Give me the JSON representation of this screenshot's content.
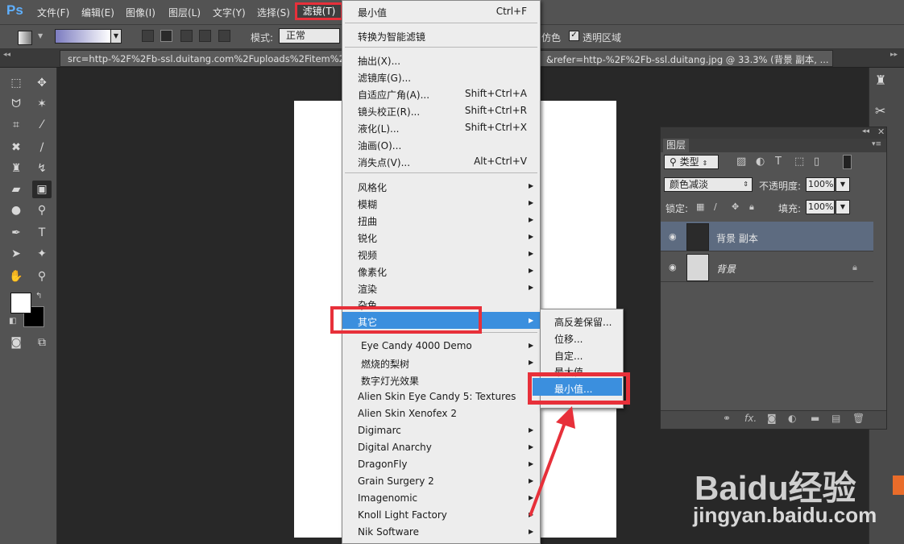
{
  "menubar": {
    "items": [
      "文件(F)",
      "编辑(E)",
      "图像(I)",
      "图层(L)",
      "文字(Y)",
      "选择(S)",
      "滤镜(T)"
    ],
    "active": "滤镜(T)"
  },
  "options": {
    "mode_label": "模式:",
    "mode_value": "正常",
    "dither_label": "仿色",
    "transparency_label": "透明区域"
  },
  "doc_tab": {
    "left_text": "src=http-%2F%2Fb-ssl.duitang.com%2Fuploads%2Fitem%2F20",
    "right_text": "&refer=http-%2F%2Fb-ssl.duitang.jpg @ 33.3% (背景 副本, ..."
  },
  "filter_menu": {
    "last_filter": {
      "label": "最小值",
      "shortcut": "Ctrl+F"
    },
    "smart": "转换为智能滤镜",
    "group1": [
      {
        "label": "抽出(X)...",
        "shortcut": ""
      },
      {
        "label": "滤镜库(G)...",
        "shortcut": ""
      },
      {
        "label": "自适应广角(A)...",
        "shortcut": "Shift+Ctrl+A"
      },
      {
        "label": "镜头校正(R)...",
        "shortcut": "Shift+Ctrl+R"
      },
      {
        "label": "液化(L)...",
        "shortcut": "Shift+Ctrl+X"
      },
      {
        "label": "油画(O)...",
        "shortcut": ""
      },
      {
        "label": "消失点(V)...",
        "shortcut": "Alt+Ctrl+V"
      }
    ],
    "group2": [
      "风格化",
      "模糊",
      "扭曲",
      "锐化",
      "视频",
      "像素化",
      "渲染",
      "杂色",
      "其它"
    ],
    "group3": [
      "Eye Candy 4000  Demo",
      "燃烧的梨树",
      "数字灯光效果",
      "Alien Skin Eye Candy 5: Textures",
      "Alien Skin Xenofex 2",
      "Digimarc",
      "Digital Anarchy",
      "DragonFly",
      "Grain Surgery 2",
      "Imagenomic",
      "Knoll Light Factory",
      "Nik Software"
    ]
  },
  "submenu": [
    "高反差保留...",
    "位移...",
    "自定...",
    "最大值",
    "最小值..."
  ],
  "layers": {
    "tab": "图层",
    "kind": "类型",
    "blend": "颜色减淡",
    "opacity_label": "不透明度:",
    "opacity": "100%",
    "lock_label": "锁定:",
    "fill_label": "填充:",
    "fill": "100%",
    "rows": [
      {
        "name": "背景 副本",
        "selected": true
      },
      {
        "name": "背景",
        "selected": false
      }
    ]
  },
  "watermark": {
    "brand": "Baidu经验",
    "url": "jingyan.baidu.com"
  },
  "colors": {
    "highlight": "#3b8fde",
    "annotation": "#e7303a",
    "menu_bg": "#ededed"
  }
}
